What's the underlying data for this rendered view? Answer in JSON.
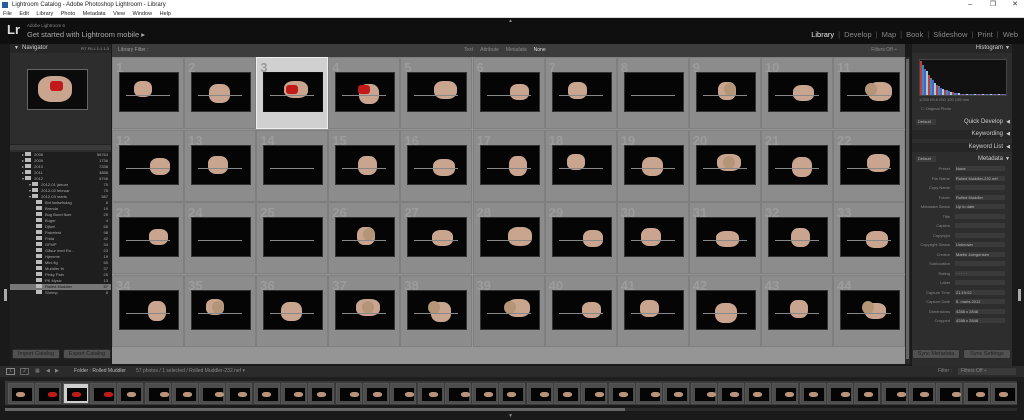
{
  "window": {
    "title": "Lightroom Catalog - Adobe Photoshop Lightroom - Library",
    "controls": [
      "–",
      "❐",
      "✕"
    ]
  },
  "menu": [
    "File",
    "Edit",
    "Library",
    "Photo",
    "Metadata",
    "View",
    "Window",
    "Help"
  ],
  "identity": {
    "logo": "Lr",
    "subtitle": "Adobe Lightroom 6",
    "main": "Get started with Lightroom mobile",
    "arrow": "▸"
  },
  "modules": [
    {
      "label": "Library",
      "active": true
    },
    {
      "label": "Develop",
      "active": false
    },
    {
      "label": "Map",
      "active": false
    },
    {
      "label": "Book",
      "active": false
    },
    {
      "label": "Slideshow",
      "active": false
    },
    {
      "label": "Print",
      "active": false
    },
    {
      "label": "Web",
      "active": false
    }
  ],
  "navigator": {
    "title": "Navigator",
    "zoom_options": "FIT  FILL  1:1  1:3"
  },
  "folders": [
    {
      "name": "2008",
      "count": "56764",
      "level": 0
    },
    {
      "name": "2009",
      "count": "1736",
      "level": 0
    },
    {
      "name": "2010",
      "count": "7338",
      "level": 0
    },
    {
      "name": "2011",
      "count": "3888",
      "level": 0
    },
    {
      "name": "2012",
      "count": "5798",
      "level": 0
    },
    {
      "name": "2012-01 januar",
      "count": "75",
      "level": 1
    },
    {
      "name": "2012-02 februar",
      "count": "75",
      "level": 1
    },
    {
      "name": "2012-03 marts",
      "count": "587",
      "level": 1
    },
    {
      "name": "Bnt fødselsdag",
      "count": "8",
      "level": 2
    },
    {
      "name": "Brenda",
      "count": "19",
      "level": 2
    },
    {
      "name": "Bug Bond fluer",
      "count": "25",
      "level": 2
    },
    {
      "name": "Buger",
      "count": "4",
      "level": 2
    },
    {
      "name": "Djfuel",
      "count": "65",
      "level": 2
    },
    {
      "name": "Fiskefest",
      "count": "98",
      "level": 2
    },
    {
      "name": "Frida",
      "count": "42",
      "level": 2
    },
    {
      "name": "GFMP",
      "count": "34",
      "level": 2
    },
    {
      "name": "Gåsur med Ro...",
      "count": "23",
      "level": 2
    },
    {
      "name": "Hjemme",
      "count": "19",
      "level": 2
    },
    {
      "name": "Mini fig",
      "count": "65",
      "level": 2
    },
    {
      "name": "Muddler fri",
      "count": "37",
      "level": 2
    },
    {
      "name": "Pinky Pain",
      "count": "25",
      "level": 2
    },
    {
      "name": "PK Mysic",
      "count": "13",
      "level": 2
    },
    {
      "name": "Rolled Muddler",
      "count": "57",
      "level": 2,
      "selected": true
    },
    {
      "name": "Shrimp",
      "count": "8",
      "level": 2
    }
  ],
  "left_buttons": {
    "import": "Import Catalog",
    "export": "Export Catalog"
  },
  "filter_bar": {
    "label": "Library Filter :",
    "options": [
      {
        "label": "Text",
        "on": false
      },
      {
        "label": "Attribute",
        "on": false
      },
      {
        "label": "Metadata",
        "on": false
      },
      {
        "label": "None",
        "on": true
      }
    ],
    "filters_off": "Filters Off ÷"
  },
  "grid": {
    "columns": 11,
    "rows": 4,
    "selected_index": 2,
    "cells": [
      {
        "i": "1",
        "t": "hand"
      },
      {
        "i": "2",
        "t": "hand"
      },
      {
        "i": "3",
        "t": "red"
      },
      {
        "i": "4",
        "t": "red"
      },
      {
        "i": "5",
        "t": "hand"
      },
      {
        "i": "6",
        "t": "hand"
      },
      {
        "i": "7",
        "t": "hand"
      },
      {
        "i": "8",
        "t": "dark"
      },
      {
        "i": "9",
        "t": "feather"
      },
      {
        "i": "10",
        "t": "hand"
      },
      {
        "i": "11",
        "t": "feather"
      },
      {
        "i": "12",
        "t": "hand"
      },
      {
        "i": "13",
        "t": "hand"
      },
      {
        "i": "14",
        "t": "dark"
      },
      {
        "i": "15",
        "t": "hand"
      },
      {
        "i": "16",
        "t": "hand"
      },
      {
        "i": "17",
        "t": "hand"
      },
      {
        "i": "18",
        "t": "hand"
      },
      {
        "i": "19",
        "t": "hand"
      },
      {
        "i": "20",
        "t": "feather"
      },
      {
        "i": "21",
        "t": "hand"
      },
      {
        "i": "22",
        "t": "hand"
      },
      {
        "i": "23",
        "t": "hand"
      },
      {
        "i": "24",
        "t": "dark"
      },
      {
        "i": "25",
        "t": "dark"
      },
      {
        "i": "26",
        "t": "feather"
      },
      {
        "i": "27",
        "t": "hand"
      },
      {
        "i": "28",
        "t": "hand"
      },
      {
        "i": "29",
        "t": "hand"
      },
      {
        "i": "30",
        "t": "hand"
      },
      {
        "i": "31",
        "t": "hand"
      },
      {
        "i": "32",
        "t": "hand"
      },
      {
        "i": "33",
        "t": "hand"
      },
      {
        "i": "34",
        "t": "hand"
      },
      {
        "i": "35",
        "t": "feather"
      },
      {
        "i": "36",
        "t": "hand"
      },
      {
        "i": "37",
        "t": "feather"
      },
      {
        "i": "38",
        "t": "feather"
      },
      {
        "i": "39",
        "t": "feather"
      },
      {
        "i": "40",
        "t": "hand"
      },
      {
        "i": "41",
        "t": "hand"
      },
      {
        "i": "42",
        "t": "hand"
      },
      {
        "i": "43",
        "t": "hand"
      },
      {
        "i": "44",
        "t": "feather"
      }
    ]
  },
  "right_headers": {
    "histogram": "Histogram",
    "quick_develop": "Quick Develop",
    "keywording": "Keywording",
    "keyword_list": "Keyword List",
    "metadata": "Metadata"
  },
  "histogram_values": "1/250   f/5.6   ISO 100   105 mm",
  "original_photo": "Original Photo",
  "quick_develop_preset": "Default",
  "metadata_preset": "Default",
  "metadata": [
    {
      "k": "Preset",
      "v": "None"
    },
    {
      "k": "File Name",
      "v": "Rolled Muddler-232.nef"
    },
    {
      "k": "Copy Name",
      "v": ""
    },
    {
      "k": "Folder",
      "v": "Rolled Muddler"
    },
    {
      "k": "Metadata Status",
      "v": "Up to date"
    },
    {
      "k": "Title",
      "v": ""
    },
    {
      "k": "Caption",
      "v": ""
    },
    {
      "k": "Copyright",
      "v": ""
    },
    {
      "k": "Copyright Status",
      "v": "Unknown"
    },
    {
      "k": "Creator",
      "v": "Martin Joergensen"
    },
    {
      "k": "Sublocation",
      "v": ""
    },
    {
      "k": "Rating",
      "v": "· · · · ·"
    },
    {
      "k": "Label",
      "v": ""
    },
    {
      "k": "Capture Time",
      "v": "21:19:02"
    },
    {
      "k": "Capture Date",
      "v": "5. marts 2012"
    },
    {
      "k": "Dimensions",
      "v": "4288 x 2848"
    },
    {
      "k": "Cropped",
      "v": "4288 x 2848"
    }
  ],
  "right_buttons": {
    "sync_metadata": "Sync Metadata",
    "sync_settings": "Sync Settings"
  },
  "toolbar": {
    "page1": "1",
    "page2": "2",
    "breadcrumb": "Folder : Rolled Muddler",
    "info": "57 photos / 1 selected / Rolled Muddler-232.nef ▾",
    "filter": "Filter :",
    "filter_value": "Filters Off ÷"
  },
  "film_red": [
    1,
    2,
    3
  ],
  "film_selected": 2
}
